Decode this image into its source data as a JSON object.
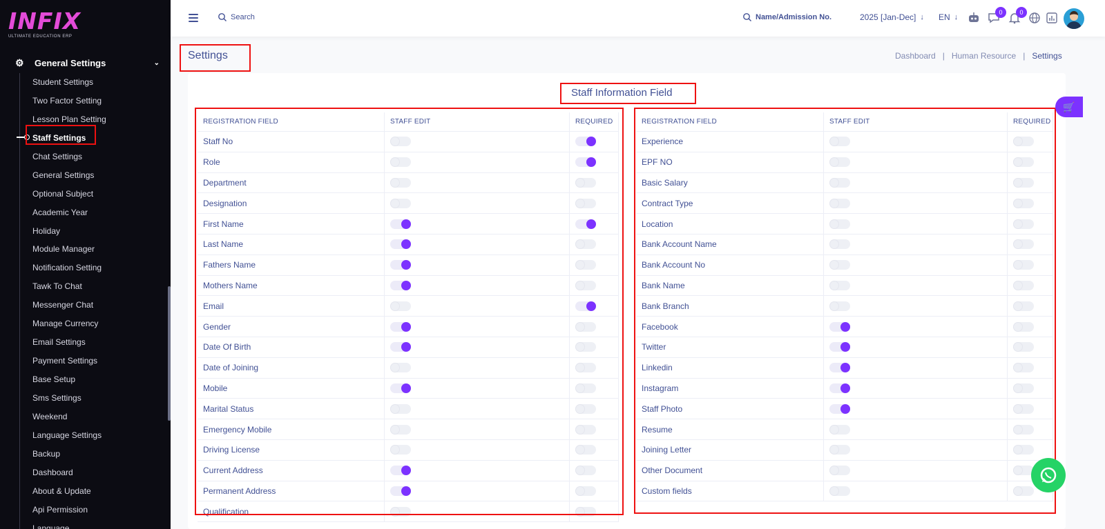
{
  "logo": {
    "text": "INFIX",
    "subtitle": "ULTIMATE EDUCATION ERP"
  },
  "sidebar": {
    "group": "General Settings",
    "items": [
      {
        "label": "Student Settings"
      },
      {
        "label": "Two Factor Setting"
      },
      {
        "label": "Lesson Plan Setting"
      },
      {
        "label": "Staff Settings",
        "active": true
      },
      {
        "label": "Chat Settings"
      },
      {
        "label": "General Settings"
      },
      {
        "label": "Optional Subject"
      },
      {
        "label": "Academic Year"
      },
      {
        "label": "Holiday"
      },
      {
        "label": "Module Manager"
      },
      {
        "label": "Notification Setting"
      },
      {
        "label": "Tawk To Chat"
      },
      {
        "label": "Messenger Chat"
      },
      {
        "label": "Manage Currency"
      },
      {
        "label": "Email Settings"
      },
      {
        "label": "Payment Settings"
      },
      {
        "label": "Base Setup"
      },
      {
        "label": "Sms Settings"
      },
      {
        "label": "Weekend"
      },
      {
        "label": "Language Settings"
      },
      {
        "label": "Backup"
      },
      {
        "label": "Dashboard"
      },
      {
        "label": "About & Update"
      },
      {
        "label": "Api Permission"
      },
      {
        "label": "Language"
      }
    ]
  },
  "header": {
    "search_placeholder": "Search",
    "admission_search": "Name/Admission No.",
    "year": "2025 [Jan-Dec]",
    "language": "EN",
    "chat_badge": "0",
    "notification_badge": "0"
  },
  "page": {
    "title": "Settings",
    "breadcrumb": [
      "Dashboard",
      "Human Resource",
      "Settings"
    ],
    "card_title": "Staff Information Field"
  },
  "table": {
    "headers": [
      "REGISTRATION FIELD",
      "STAFF EDIT",
      "REQUIRED"
    ],
    "left": [
      {
        "field": "Staff No",
        "staff_edit": false,
        "required": true
      },
      {
        "field": "Role",
        "staff_edit": false,
        "required": true
      },
      {
        "field": "Department",
        "staff_edit": false,
        "required": false
      },
      {
        "field": "Designation",
        "staff_edit": false,
        "required": false
      },
      {
        "field": "First Name",
        "staff_edit": true,
        "required": true
      },
      {
        "field": "Last Name",
        "staff_edit": true,
        "required": false
      },
      {
        "field": "Fathers Name",
        "staff_edit": true,
        "required": false
      },
      {
        "field": "Mothers Name",
        "staff_edit": true,
        "required": false
      },
      {
        "field": "Email",
        "staff_edit": false,
        "required": true
      },
      {
        "field": "Gender",
        "staff_edit": true,
        "required": false
      },
      {
        "field": "Date Of Birth",
        "staff_edit": true,
        "required": false
      },
      {
        "field": "Date of Joining",
        "staff_edit": false,
        "required": false
      },
      {
        "field": "Mobile",
        "staff_edit": true,
        "required": false
      },
      {
        "field": "Marital Status",
        "staff_edit": false,
        "required": false
      },
      {
        "field": "Emergency Mobile",
        "staff_edit": false,
        "required": false
      },
      {
        "field": "Driving License",
        "staff_edit": false,
        "required": false
      },
      {
        "field": "Current Address",
        "staff_edit": true,
        "required": false
      },
      {
        "field": "Permanent Address",
        "staff_edit": true,
        "required": false
      },
      {
        "field": "Qualification",
        "staff_edit": false,
        "required": false
      }
    ],
    "right": [
      {
        "field": "Experience",
        "staff_edit": false,
        "required": false
      },
      {
        "field": "EPF NO",
        "staff_edit": false,
        "required": false
      },
      {
        "field": "Basic Salary",
        "staff_edit": false,
        "required": false
      },
      {
        "field": "Contract Type",
        "staff_edit": false,
        "required": false
      },
      {
        "field": "Location",
        "staff_edit": false,
        "required": false
      },
      {
        "field": "Bank Account Name",
        "staff_edit": false,
        "required": false
      },
      {
        "field": "Bank Account No",
        "staff_edit": false,
        "required": false
      },
      {
        "field": "Bank Name",
        "staff_edit": false,
        "required": false
      },
      {
        "field": "Bank Branch",
        "staff_edit": false,
        "required": false
      },
      {
        "field": "Facebook",
        "staff_edit": true,
        "required": false
      },
      {
        "field": "Twitter",
        "staff_edit": true,
        "required": false
      },
      {
        "field": "Linkedin",
        "staff_edit": true,
        "required": false
      },
      {
        "field": "Instagram",
        "staff_edit": true,
        "required": false
      },
      {
        "field": "Staff Photo",
        "staff_edit": true,
        "required": false
      },
      {
        "field": "Resume",
        "staff_edit": false,
        "required": false
      },
      {
        "field": "Joining Letter",
        "staff_edit": false,
        "required": false
      },
      {
        "field": "Other Document",
        "staff_edit": false,
        "required": false
      },
      {
        "field": "Custom fields",
        "staff_edit": false,
        "required": false
      }
    ]
  },
  "colors": {
    "accent": "#7c32ff",
    "highlight_box": "#ee1111",
    "sidebar_bg": "#0c0c13",
    "text": "#415094",
    "whatsapp": "#25d366"
  },
  "icons": [
    "hamburger-icon",
    "search-icon",
    "robot-icon",
    "chat-icon",
    "bell-icon",
    "globe-icon",
    "chart-icon",
    "cart-icon",
    "whatsapp-icon"
  ]
}
